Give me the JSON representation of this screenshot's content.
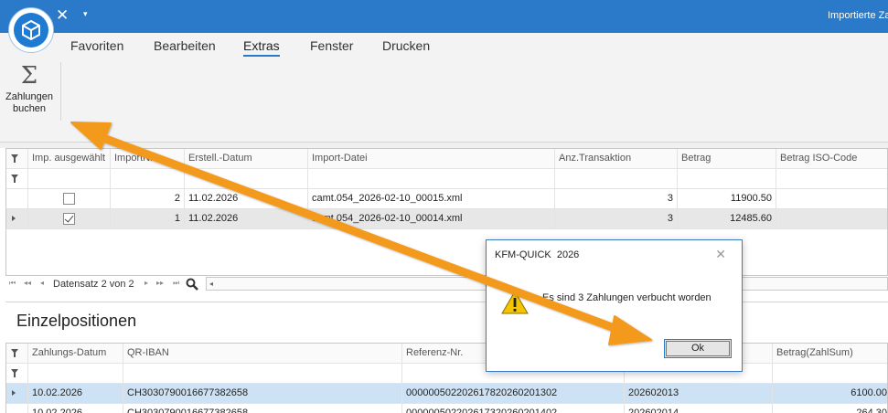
{
  "window": {
    "title": "Importierte Za",
    "close_glyph": "✕",
    "dropdown_glyph": "▾"
  },
  "menu": {
    "tabs": [
      {
        "label": "Favoriten"
      },
      {
        "label": "Bearbeiten"
      },
      {
        "label": "Extras",
        "active": true
      },
      {
        "label": "Fenster"
      },
      {
        "label": "Drucken"
      }
    ]
  },
  "ribbon": {
    "button_icon": "Σ",
    "button_line1": "Zahlungen",
    "button_line2": "buchen"
  },
  "import_grid": {
    "headers": [
      "Imp. ausgewählt",
      "ImportNr.",
      "Erstell.-Datum",
      "Import-Datei",
      "Anz.Transaktion",
      "Betrag",
      "Betrag ISO-Code"
    ],
    "rows": [
      {
        "checked": false,
        "nr": "2",
        "datum": "11.02.2026",
        "datei": "camt.054_2026-02-10_00015.xml",
        "anz": "3",
        "betrag": "11900.50",
        "iso": ""
      },
      {
        "checked": true,
        "nr": "1",
        "datum": "11.02.2026",
        "datei": "camt.054_2026-02-10_00014.xml",
        "anz": "3",
        "betrag": "12485.60",
        "iso": ""
      }
    ]
  },
  "navigator": {
    "first": "⏮",
    "prev_page": "◂◂",
    "prev": "◂",
    "record_text": "Datensatz 2 von 2",
    "next": "▸",
    "next_page": "▸▸",
    "last": "⏭",
    "scroll_left": "◂"
  },
  "section": {
    "title": "Einzelpositionen"
  },
  "detail_grid": {
    "headers": [
      "Zahlungs-Datum",
      "QR-IBAN",
      "Referenz-Nr.",
      "",
      "Betrag(ZahlSum)"
    ],
    "rows": [
      {
        "datum": "10.02.2026",
        "iban": "CH3030790016677382658",
        "ref": "000000502202617820260201302",
        "col4": "202602013",
        "betrag": "6100.00"
      },
      {
        "datum": "10.02.2026",
        "iban": "CH3030790016677382658",
        "ref": "000000502202617320260201402",
        "col4": "202602014",
        "betrag": "264.30"
      }
    ]
  },
  "dialog": {
    "title": "KFM-QUICK  2026",
    "close_glyph": "✕",
    "message": "Es sind 3 Zahlungen verbucht worden",
    "ok_label": "Ok"
  },
  "colors": {
    "titlebar": "#2b79c9",
    "arrow": "#f39a1e",
    "highlight_row": "#cde3f5"
  }
}
